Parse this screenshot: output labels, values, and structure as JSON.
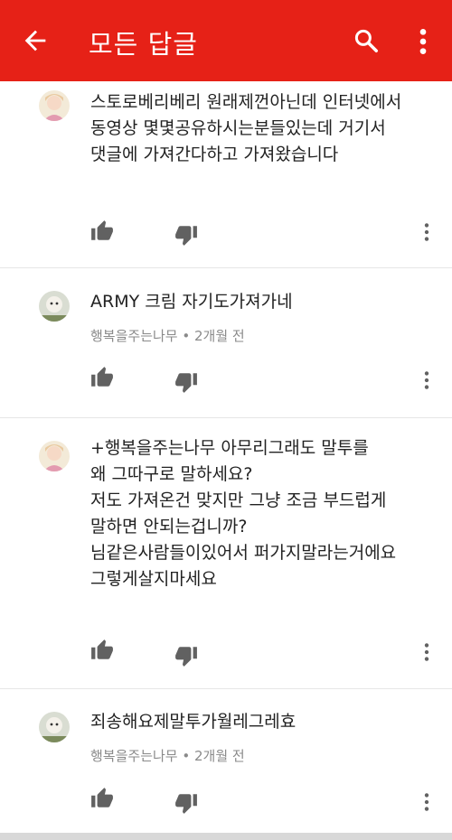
{
  "appbar": {
    "title": "모든 답글"
  },
  "comments": [
    {
      "text": "스토로베리베리 원래제껀아닌데 인터넷에서\n동영상 몇몇공유하시는분들있는데 거기서\n댓글에  가져간다하고 가져왔습니다",
      "meta": ""
    },
    {
      "text": "ARMY 크림 자기도가져가네",
      "meta": "행복을주는나무 • 2개월 전"
    },
    {
      "text": "+행복을주는나무 아무리그래도 말투를\n왜 그따구로 말하세요?\n저도 가져온건 맞지만 그냥 조금 부드럽게\n말하면 안되는겁니까?\n님같은사람들이있어서 퍼가지말라는거에요\n그렇게살지마세요",
      "meta": ""
    },
    {
      "text": "죄송해요제말투가월레그레효",
      "meta": "행복을주는나무 • 2개월 전"
    }
  ]
}
